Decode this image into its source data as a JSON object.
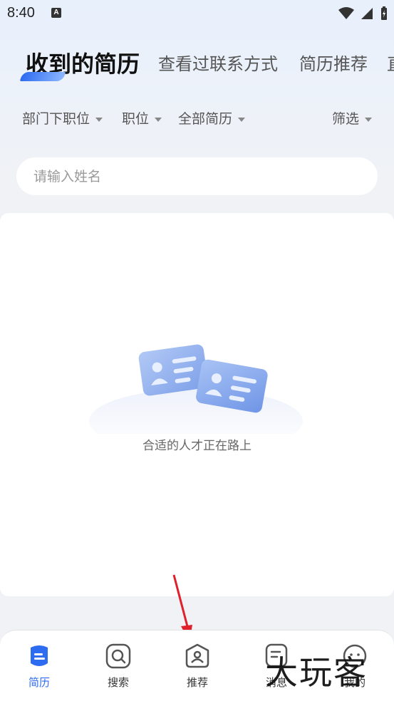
{
  "status_bar": {
    "time": "8:40",
    "a_badge": "A"
  },
  "tabs": [
    {
      "label": "收到的简历",
      "active": true
    },
    {
      "label": "查看过联系方式",
      "active": false
    },
    {
      "label": "简历推荐",
      "active": false
    },
    {
      "label": "直",
      "active": false
    }
  ],
  "filters": [
    {
      "label": "部门下职位"
    },
    {
      "label": "职位"
    },
    {
      "label": "全部简历"
    },
    {
      "label": "筛选"
    }
  ],
  "search": {
    "placeholder": "请输入姓名",
    "value": ""
  },
  "empty_state": {
    "text": "合适的人才正在路上"
  },
  "bottom_nav": [
    {
      "label": "简历",
      "icon": "resume-icon",
      "active": true
    },
    {
      "label": "搜索",
      "icon": "search-icon",
      "active": false
    },
    {
      "label": "推荐",
      "icon": "recommend-icon",
      "active": false
    },
    {
      "label": "消息",
      "icon": "message-icon",
      "active": false
    },
    {
      "label": "我的",
      "icon": "profile-icon",
      "active": false
    }
  ],
  "watermark": "大玩客",
  "colors": {
    "accent": "#2d6bf0",
    "annotation": "#e0202a"
  }
}
